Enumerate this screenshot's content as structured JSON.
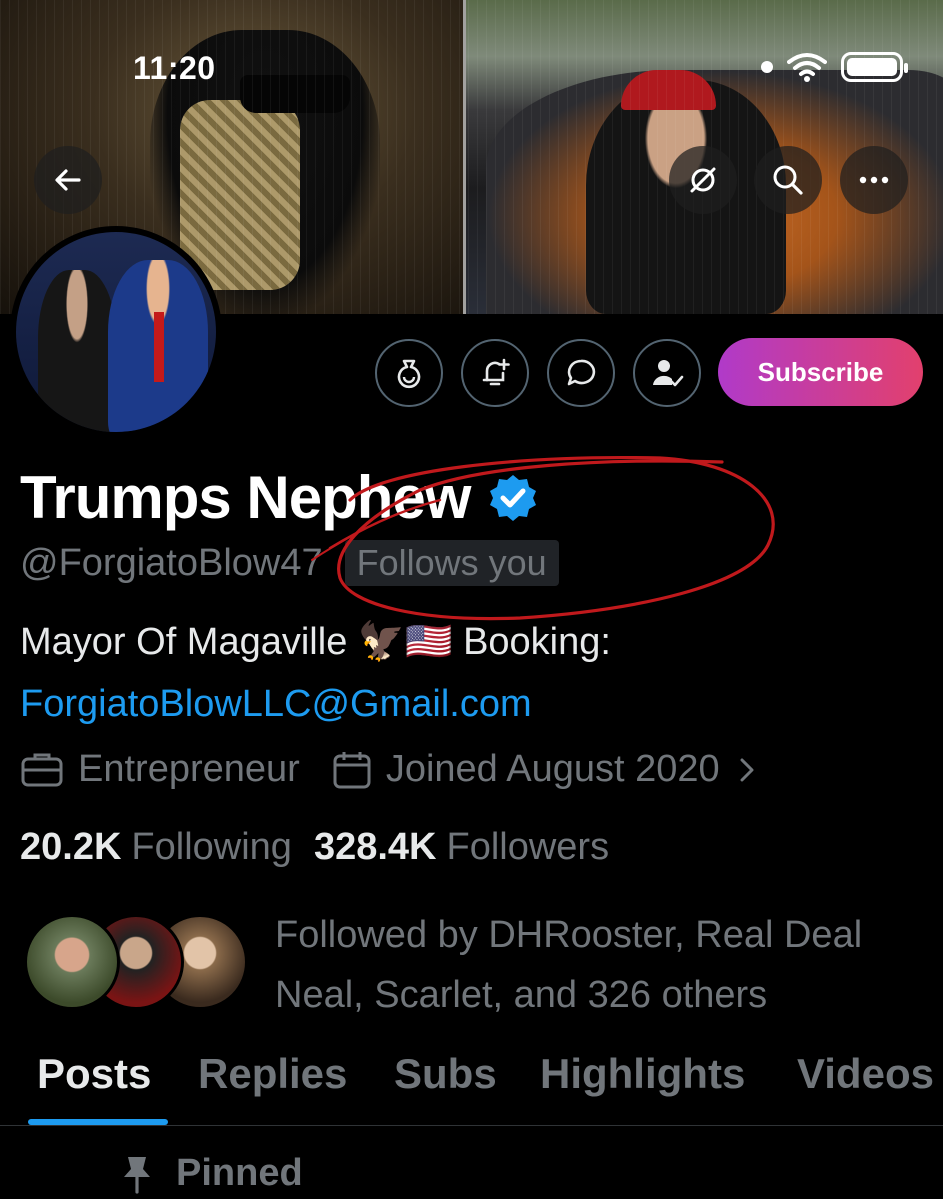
{
  "status_bar": {
    "time": "11:20"
  },
  "profile": {
    "display_name": "Trumps Nephew",
    "handle": "@ForgiatoBlow47",
    "follows_you": "Follows you",
    "bio_line1": "Mayor Of Magaville 🦅🇺🇸 Booking:",
    "bio_email": "ForgiatoBlowLLC@Gmail.com",
    "category": "Entrepreneur",
    "joined": "Joined August 2020",
    "following_count": "20.2K",
    "following_label": "Following",
    "followers_count": "328.4K",
    "followers_label": "Followers",
    "followed_by": "Followed by DHRooster, Real Deal Neal, Scarlet, and 326 others"
  },
  "actions": {
    "subscribe_label": "Subscribe"
  },
  "header_icons": [
    "back-arrow-icon",
    "unmute-icon",
    "search-icon",
    "more-icon"
  ],
  "action_icons": [
    "tip-jar-icon",
    "notification-bell-icon",
    "message-icon",
    "following-user-icon"
  ],
  "tabs": [
    {
      "label": "Posts",
      "active": true
    },
    {
      "label": "Replies",
      "active": false
    },
    {
      "label": "Subs",
      "active": false
    },
    {
      "label": "Highlights",
      "active": false
    },
    {
      "label": "Videos",
      "active": false
    }
  ],
  "pinned_label": "Pinned",
  "colors": {
    "background": "#000000",
    "accent_blue": "#1d9bf0",
    "muted_text": "#71767b",
    "subscribe_gradient_start": "#b03ac9",
    "subscribe_gradient_end": "#e2406d",
    "annotation_red": "#c0191c"
  }
}
